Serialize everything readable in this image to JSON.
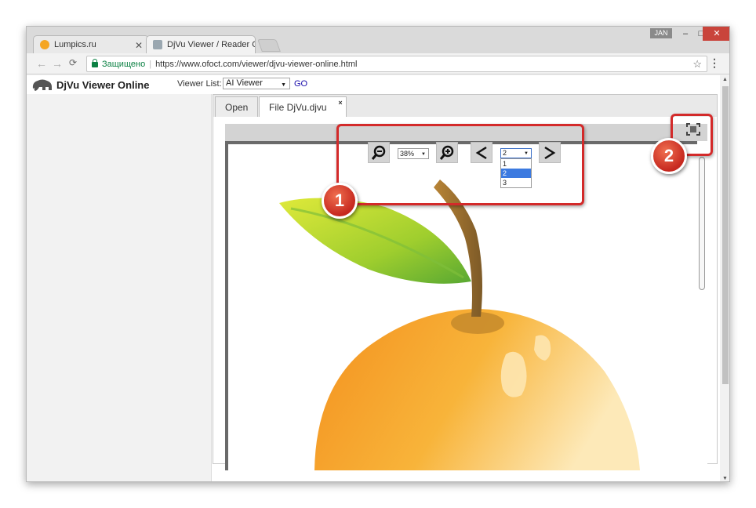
{
  "browser": {
    "tabs": [
      {
        "title": "Lumpics.ru",
        "favicon_color": "#f5a623"
      },
      {
        "title": "DjVu Viewer / Reader On",
        "favicon_color": "#9aa7b0"
      }
    ],
    "user_badge": "JAN",
    "window_controls": {
      "minimize": "–",
      "maximize": "□",
      "close": "✕"
    },
    "nav": {
      "back": "←",
      "forward": "→",
      "reload": "C"
    },
    "secure_label": "Защищено",
    "url": "https://www.ofoct.com/viewer/djvu-viewer-online.html"
  },
  "site": {
    "logo_title": "DjVu Viewer Online",
    "viewer_list_label": "Viewer List:",
    "viewer_list_value": "AI Viewer",
    "go_label": "GO"
  },
  "viewer": {
    "tabs": [
      {
        "label": "Open"
      },
      {
        "label": "File DjVu.djvu",
        "close": "×"
      }
    ],
    "controls": {
      "zoom_value": "38%",
      "page_value": "2",
      "page_options": [
        "1",
        "2",
        "3"
      ],
      "selected_page_option": "2"
    }
  },
  "annotations": [
    {
      "number": "1",
      "color": "#d32a2a"
    },
    {
      "number": "2",
      "color": "#d32a2a"
    }
  ]
}
